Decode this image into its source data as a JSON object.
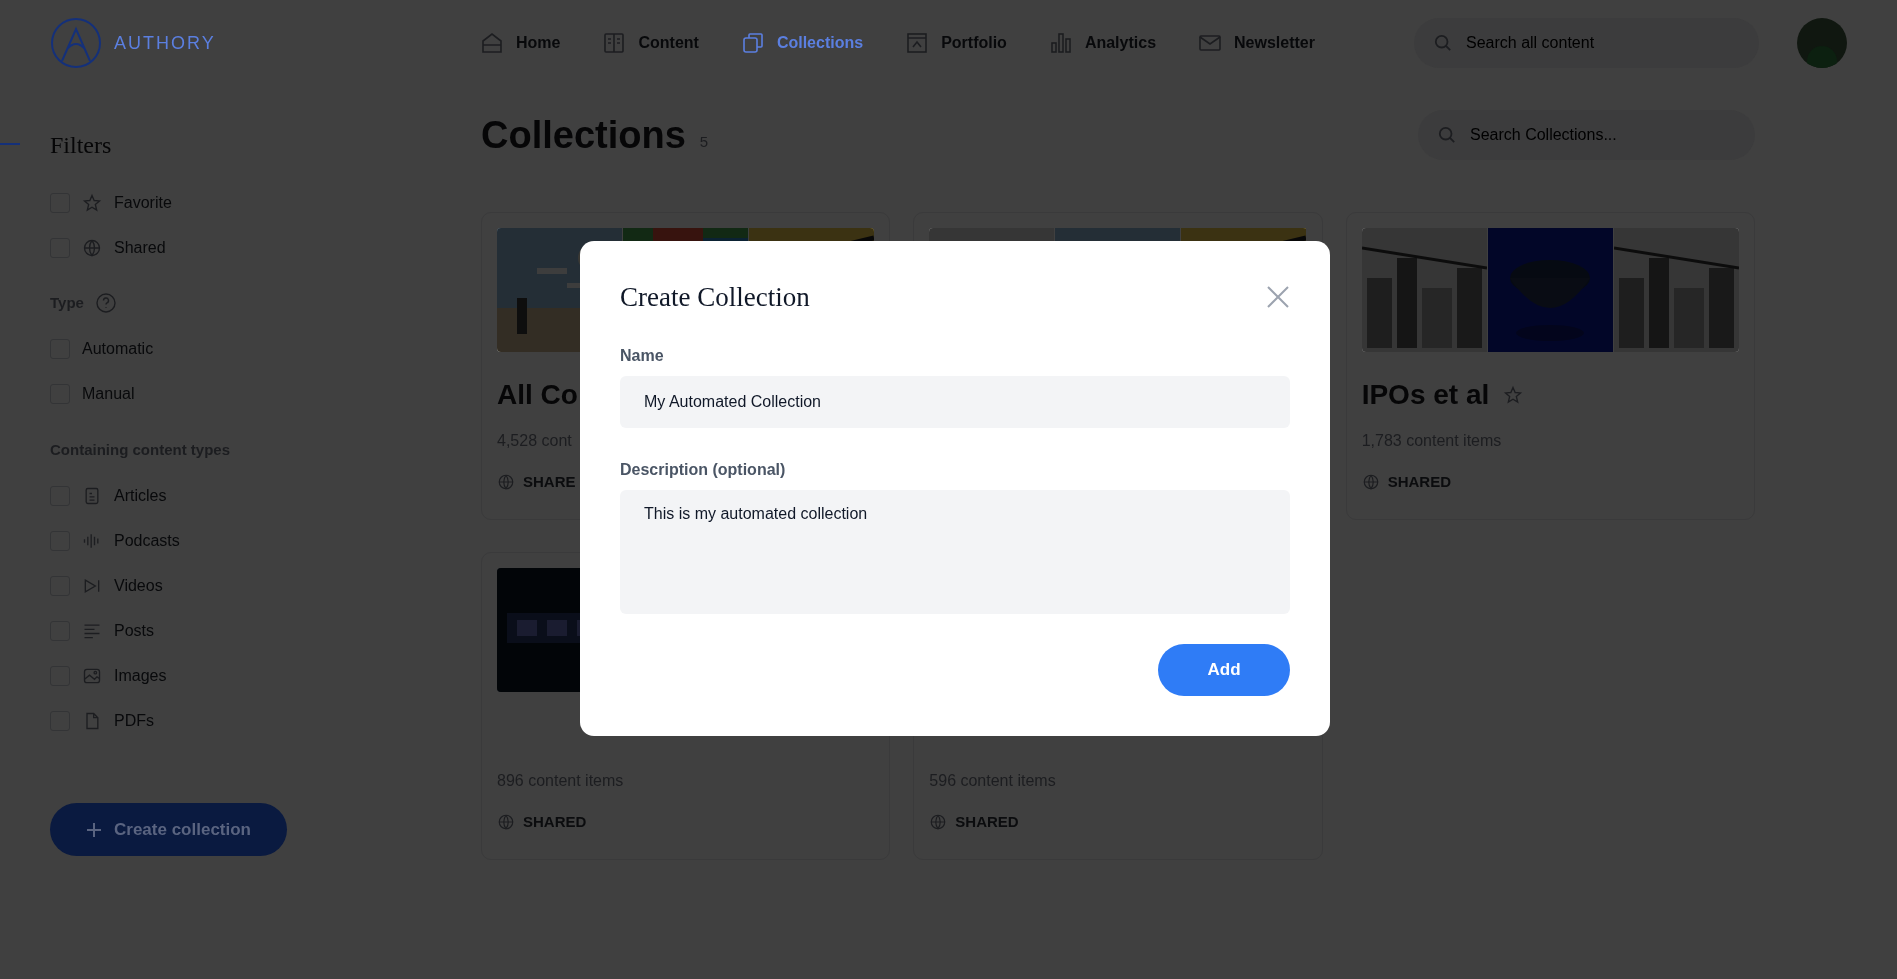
{
  "nav": {
    "brand": "AUTHORY",
    "items": [
      {
        "label": "Home",
        "selected": false
      },
      {
        "label": "Content",
        "selected": false
      },
      {
        "label": "Collections",
        "selected": true
      },
      {
        "label": "Portfolio",
        "selected": false
      },
      {
        "label": "Analytics",
        "selected": false
      },
      {
        "label": "Newsletter",
        "selected": false
      }
    ],
    "search": {
      "placeholder": "Search all content"
    }
  },
  "sidebar": {
    "title": "Filters",
    "groups": [
      {
        "items": [
          {
            "label": "Favorite",
            "checked": false
          },
          {
            "label": "Shared",
            "checked": false
          }
        ]
      },
      {
        "heading": "Type",
        "items": [
          {
            "label": "Automatic",
            "checked": false
          },
          {
            "label": "Manual",
            "checked": false
          }
        ]
      },
      {
        "heading": "Containing content types",
        "items": [
          {
            "label": "Articles",
            "checked": false
          },
          {
            "label": "Podcasts",
            "checked": false
          },
          {
            "label": "Videos",
            "checked": false
          },
          {
            "label": "Posts",
            "checked": false
          },
          {
            "label": "Images",
            "checked": false
          },
          {
            "label": "PDFs",
            "checked": false
          }
        ]
      }
    ],
    "create_button": "Create collection"
  },
  "main": {
    "title": "Collections",
    "count": "5",
    "search": {
      "placeholder": "Search Collections..."
    },
    "cards": [
      {
        "covers": [
          {
            "kind": "picture"
          },
          {
            "kind": "picture"
          },
          {
            "kind": "picture"
          }
        ],
        "title": "All Co",
        "count": "4,528 cont",
        "shared": "SHARE"
      },
      {
        "covers": [
          {
            "kind": "picture"
          },
          {
            "kind": "picture"
          },
          {
            "kind": "picture"
          }
        ]
      },
      {
        "covers": [
          {
            "kind": "picture"
          },
          {
            "kind": "picture"
          },
          {
            "kind": "picture"
          }
        ],
        "title": "IPOs et al",
        "favorite": false,
        "count": "1,783 content items",
        "shared": "SHARED"
      },
      {
        "covers": [
          {
            "kind": "picture"
          }
        ],
        "count": "896 content items",
        "shared": "SHARED"
      },
      {
        "count": "596 content items",
        "shared": "SHARED"
      }
    ]
  },
  "modal": {
    "title": "Create Collection",
    "fields": [
      {
        "kind": "input",
        "label": "Name",
        "value": "My Automated Collection"
      },
      {
        "kind": "textarea",
        "label": "Description (optional)",
        "value": "This is my automated collection"
      }
    ],
    "button": "Add"
  }
}
